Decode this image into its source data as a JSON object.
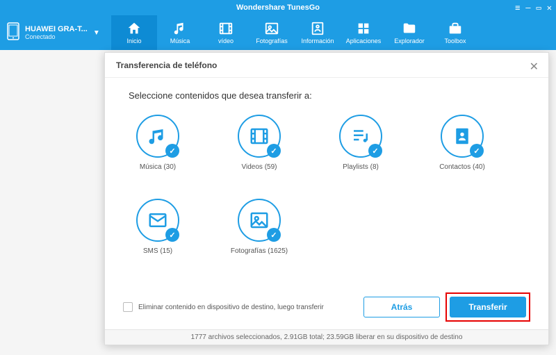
{
  "app": {
    "title": "Wondershare TunesGo"
  },
  "device": {
    "name": "HUAWEI GRA-T...",
    "status": "Conectado"
  },
  "nav": {
    "home": "Inicio",
    "music": "Música",
    "video": "vídeo",
    "photos": "Fotografías",
    "info": "Información",
    "apps": "Aplicaciones",
    "explorer": "Explorador",
    "toolbox": "Toolbox"
  },
  "dialog": {
    "title": "Transferencia de teléfono",
    "instruction": "Seleccione contenidos que desea transferir a:",
    "items": {
      "music": "Música (30)",
      "videos": "Videos (59)",
      "playlists": "Playlists (8)",
      "contacts": "Contactos (40)",
      "sms": "SMS (15)",
      "photos": "Fotografías (1625)"
    },
    "erase_label": "Eliminar contenido en dispositivo de destino, luego transferir",
    "back": "Atrás",
    "transfer": "Transferir",
    "status": "1777 archivos seleccionados, 2.91GB total; 23.59GB liberar en su dispositivo de destino"
  }
}
